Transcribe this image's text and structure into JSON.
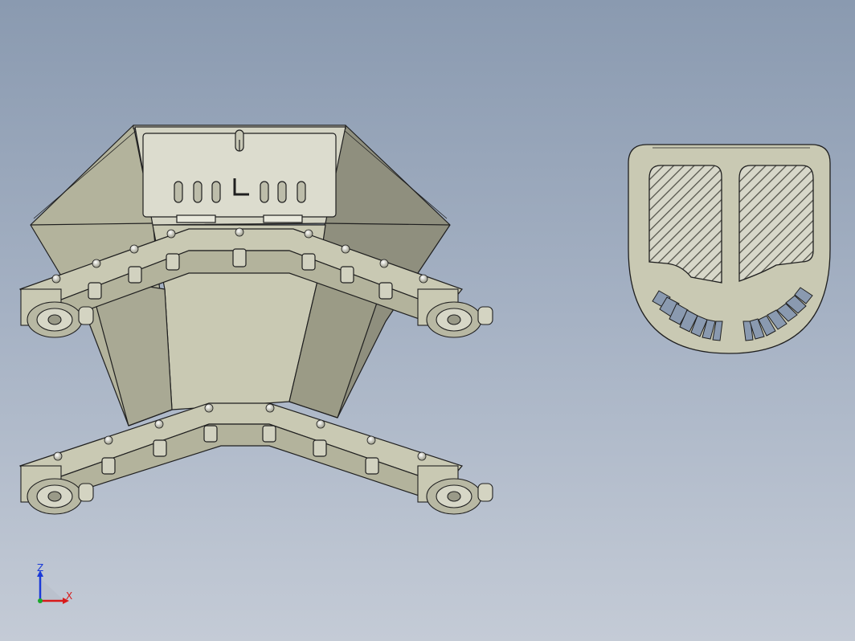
{
  "viewport": {
    "background_top": "#8a9ab0",
    "background_bottom": "#c4cbd6"
  },
  "model": {
    "part_fill": "#c9c9b3",
    "part_dark": "#8f8f7e",
    "part_mid": "#b3b39c",
    "edge_color": "#1f1f1f"
  },
  "triad": {
    "z_label": "Z",
    "x_label": "X",
    "z_color": "#1a3ad8",
    "x_color": "#d81a1a",
    "origin_color": "#1aa82a"
  }
}
